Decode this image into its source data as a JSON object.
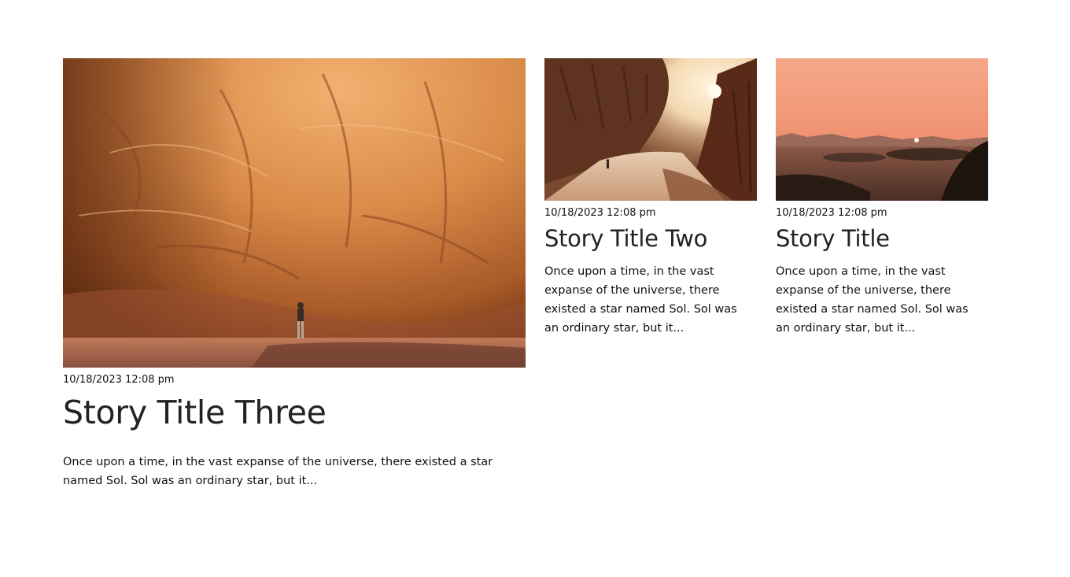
{
  "posts": [
    {
      "date": "10/18/2023 12:08 pm",
      "title": "Story Title Three",
      "excerpt": "Once upon a time, in the vast expanse of the universe, there existed a star named Sol. Sol was an ordinary star, but it..."
    },
    {
      "date": "10/18/2023 12:08 pm",
      "title": "Story Title Two",
      "excerpt": "Once upon a time, in the vast expanse of the universe, there existed a star named Sol. Sol was an ordinary star, but it..."
    },
    {
      "date": "10/18/2023 12:08 pm",
      "title": "Story Title",
      "excerpt": "Once upon a time, in the vast expanse of the universe, there existed a star named Sol. Sol was an ordinary star, but it..."
    }
  ],
  "colors": {
    "sandstone_light": "#e8a060",
    "sandstone_dark": "#7a3a18",
    "sunset_sky": "#f0a07a",
    "canyon_shadow": "#3a2418"
  }
}
